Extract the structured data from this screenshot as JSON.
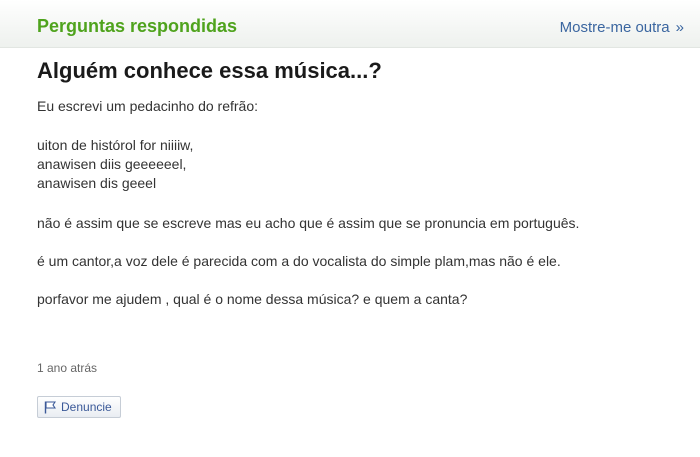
{
  "header": {
    "section_title": "Perguntas respondidas",
    "more_link": "Mostre-me outra",
    "more_link_icon": "raquo",
    "more_link_glyph": "»"
  },
  "question": {
    "title": "Alguém conhece essa música...?",
    "intro": "Eu escrevi um pedacinho do refrão:",
    "lyrics": [
      "uiton de histórol for niiiiw,",
      "anawisen diis geeeeeel,",
      "anawisen dis geeel"
    ],
    "note": "não é assim que se escreve mas eu acho que é assim que se pronuncia em português.",
    "voice_hint": "é um cantor,a voz dele é parecida com a do vocalista do simple plam,mas não é ele.",
    "request": "porfavor me ajudem , qual é o nome dessa música? e quem a canta?",
    "timestamp": "1 ano atrás"
  },
  "actions": {
    "report_label": "Denuncie",
    "report_icon": "flag-icon"
  },
  "colors": {
    "section_title": "#4fa31d",
    "link": "#3b66a0"
  }
}
